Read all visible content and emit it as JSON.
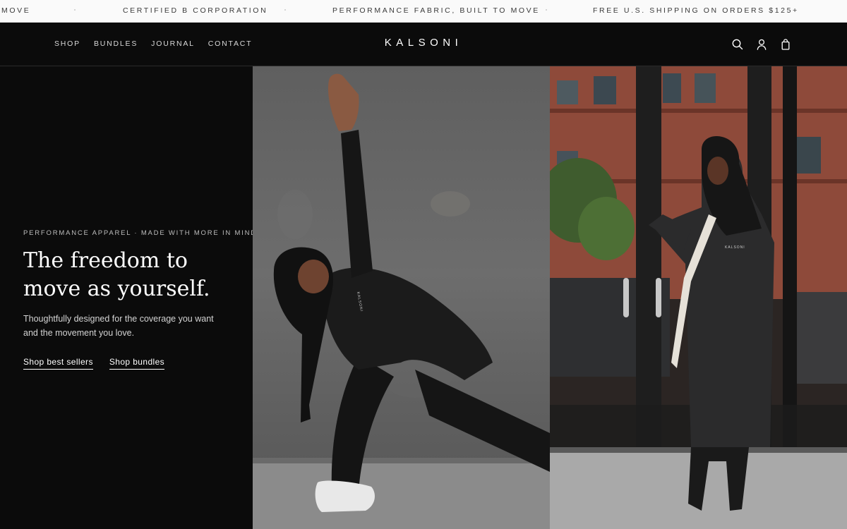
{
  "announcement": {
    "items": [
      "MOVE",
      "CERTIFIED B CORPORATION",
      "PERFORMANCE FABRIC, BUILT TO MOVE",
      "FREE U.S. SHIPPING ON ORDERS $125+"
    ]
  },
  "header": {
    "logo": "KALSONI",
    "nav": [
      "SHOP",
      "BUNDLES",
      "JOURNAL",
      "CONTACT"
    ],
    "icons": [
      "search-icon",
      "account-icon",
      "bag-icon"
    ]
  },
  "hero": {
    "eyebrow": "PERFORMANCE APPAREL · MADE WITH MORE IN MIND",
    "headline_line1": "The freedom to",
    "headline_line2": "move as yourself.",
    "subtext": "Thoughtfully designed for the coverage you want and the movement you love.",
    "cta_primary": "Shop best sellers",
    "cta_secondary": "Shop bundles"
  },
  "images": {
    "left_shirt_text": "KALSONI",
    "right_shirt_text": "KALSONI"
  },
  "colors": {
    "background": "#0b0b0b",
    "announcement_bg": "#fafafa",
    "text_light": "#ffffff",
    "brick": "#8e4a3a"
  }
}
